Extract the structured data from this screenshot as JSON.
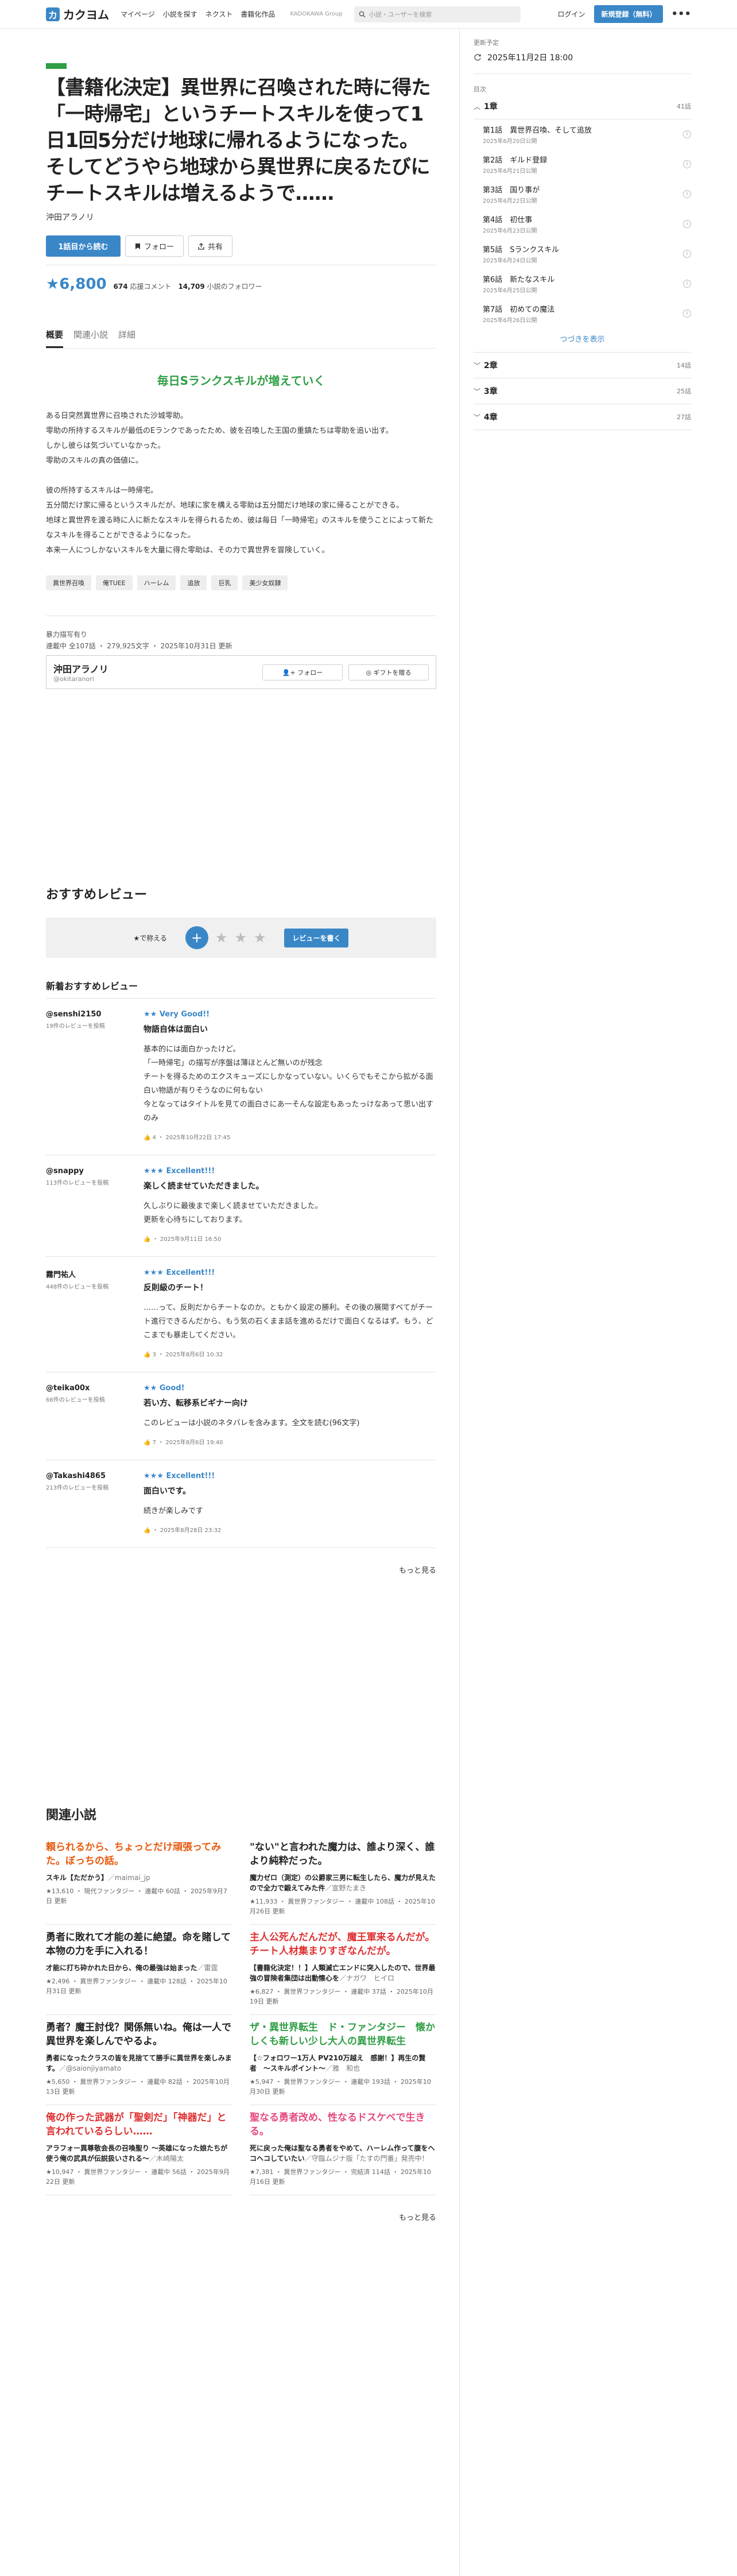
{
  "header": {
    "logo_mark": "カ",
    "logo_text": "カクヨム",
    "nav": [
      "マイページ",
      "小説を探す",
      "ネクスト",
      "書籍化作品"
    ],
    "kadokawa": "KADOKAWA Group",
    "search_placeholder": "小説・ユーザーを検索",
    "login": "ログイン",
    "register": "新規登録（無料）",
    "more": "•••"
  },
  "work": {
    "title": "【書籍化決定】異世界に召喚された時に得た「一時帰宅」というチートスキルを使って1日1回5分だけ地球に帰れるようになった。そしてどうやら地球から異世界に戻るたびにチートスキルは増えるようで……",
    "author": "沖田アラノリ",
    "read_btn": "1話目から読む",
    "follow_btn": "フォロー",
    "share_btn": "共有",
    "score": "★6,800",
    "comments_num": "674",
    "comments_label": " 応援コメント",
    "followers_num": "14,709",
    "followers_label": " 小説のフォロワー"
  },
  "tabs": [
    "概要",
    "関連小説",
    "詳細"
  ],
  "catchphrase": "毎日Sランクスキルが増えていく",
  "intro": "ある日突然異世界に召喚された沙城零助。\n零助の所持するスキルが最低のEランクであったため、彼を召喚した王国の重鎮たちは零助を追い出す。\nしかし彼らは気づいていなかった。\n零助のスキルの真の価値に。\n\n彼の所持するスキルは一時帰宅。\n五分間だけ家に帰るというスキルだが、地球に家を構える零助は五分間だけ地球の家に帰ることができる。\n地球と異世界を渡る時に人に新たなスキルを得られるため、彼は毎日「一時帰宅」のスキルを使うことによって新たなスキルを得ることができるようになった。\n本来一人につしかないスキルを大量に得た零助は、その力で異世界を冒険していく。",
  "tags": [
    "異世界召喚",
    "俺TUEE",
    "ハーレム",
    "追放",
    "巨乳",
    "美少女奴隷"
  ],
  "meta": {
    "line1": "暴力描写有り",
    "line2": "連載中 全107話 ・ 279,925文字 ・ 2025年10月31日 更新"
  },
  "author_card": {
    "name": "沖田アラノリ",
    "id": "@okitaranori",
    "follow": "フォロー",
    "gift": "ギフトを贈る"
  },
  "reviews_section": {
    "title": "おすすめレビュー",
    "rate_label": "★で称える",
    "plus": "+",
    "stars": [
      "★",
      "★",
      "★"
    ],
    "write_btn": "レビューを書く",
    "new_title": "新着おすすめレビュー",
    "more": "もっと見る"
  },
  "reviews": [
    {
      "user": "@senshi2150",
      "count": "19件のレビューを投稿",
      "rating": "★★ Very Good!!",
      "headline": "物語自体は面白い",
      "body": "基本的には面白かったけど。\n「一時帰宅」の描写が序盤は薄ほとんど無いのが残念\nチートを得るためのエクスキューズにしかなっていない。いくらでもそこから拡がる面白い物語が有りそうなのに何もない\n今となってはタイトルを見ての面白さにあ一そんな設定もあったっけなあって思い出すのみ",
      "likes": "4",
      "date": "2025年10月22日 17:45"
    },
    {
      "user": "@snappy",
      "count": "113件のレビューを投稿",
      "rating": "★★★ Excellent!!!",
      "headline": "楽しく読ませていただきました。",
      "body": "久しぶりに最後まで楽しく読ませていただきました。\n更新を心待ちにしております。",
      "likes": "",
      "date": "2025年9月11日 16:50"
    },
    {
      "user": "霧門祐人",
      "count": "448件のレビューを投稿",
      "rating": "★★★ Excellent!!!",
      "headline": "反則級のチート！",
      "body": "……って、反則だからチートなのか。ともかく設定の勝利。その後の展開すべてがチート進行できるんだから、もう気の石くまま話を進めるだけで面白くなるはず。もう、どこまでも暴走してください。",
      "likes": "3",
      "date": "2025年8月6日 10:32"
    },
    {
      "user": "@teika00x",
      "count": "66件のレビューを投稿",
      "rating": "★★ Good!",
      "headline": "若い方、転移系ビギナー向け",
      "body": "このレビューは小説のネタバレを含みます。全文を読む(96文字)",
      "likes": "7",
      "date": "2025年8月6日 19:40"
    },
    {
      "user": "@Takashi4865",
      "count": "213件のレビューを投稿",
      "rating": "★★★ Excellent!!!",
      "headline": "面白いです。",
      "body": "続きが楽しみです",
      "likes": "",
      "date": "2025年8月28日 23:32"
    }
  ],
  "related": {
    "title": "関連小説",
    "more": "もっと見る",
    "items": [
      {
        "name": "頼られるから、ちょっとだけ頑張ってみた。ぼっちの話。",
        "color": "#e8590c",
        "catch": "スキル【ただかう】",
        "author": "／maimai_jp",
        "meta": "★13,610 ・ 現代ファンタジー ・ 連載中 60話 ・ 2025年9月7日 更新"
      },
      {
        "name": "\"ない\"と言われた魔力は、誰より深く、誰より純粋だった。",
        "color": "#222222",
        "catch": "魔力ゼロ（測定）の公爵家三男に転生したら、魔力が見えたので全力で鍛えてみた件",
        "author": "／宣野たまき",
        "meta": "★11,933 ・ 異世界ファンタジー ・ 連載中 108話 ・ 2025年10月26日 更新"
      },
      {
        "name": "勇者に敗れて才能の差に絶望。命を賭して本物の力を手に入れる！",
        "color": "#222222",
        "catch": "才能に打ち砕かれた日から、俺の最強は始まった",
        "author": "／雷霆",
        "meta": "★2,496 ・ 異世界ファンタジー ・ 連載中 128話 ・ 2025年10月31日 更新"
      },
      {
        "name": "主人公死んだんだが、魔王軍来るんだが。チート人材集まりすぎなんだが。",
        "color": "#e03131",
        "catch": "【書籍化決定！！】人類滅亡エンドに突入したので、世界最強の冒険者集団は出動懐心を",
        "author": "／ナガワ　ヒイロ",
        "meta": "★6,827 ・ 異世界ファンタジー ・ 連載中 37話 ・ 2025年10月19日 更新"
      },
      {
        "name": "勇者？魔王討伐？関係無いね。俺は一人で異世界を楽しんでやるよ。",
        "color": "#222222",
        "catch": "勇者になったクラスの皆を見捨てて勝手に異世界を楽しみます。",
        "author": "／@saionjiyamato",
        "meta": "★5,650 ・ 異世界ファンタジー ・ 連載中 82話 ・ 2025年10月13日 更新"
      },
      {
        "name": "ザ・異世界転生　ド・ファンタジー　懐かしくも新しい少し大人の異世界転生",
        "color": "#2f9e44",
        "catch": "【☆フォロワー1万人 PV210万越え　感謝！】再生の賢者　〜スキルポイント〜",
        "author": "／雅　和也",
        "meta": "★5,947 ・ 異世界ファンタジー ・ 連載中 193話 ・ 2025年10月30日 更新"
      },
      {
        "name": "俺の作った武器が「聖剣だ」「神器だ」と言われているらしい……",
        "color": "#e03131",
        "catch": "アラフォー異尊敬会長の召喚聖り 〜英雄になった娘たちが使う俺の武具が伝説扱いされる〜",
        "author": "／木崎陽太",
        "meta": "★10,947 ・ 異世界ファンタジー ・ 連載中 56話 ・ 2025年9月22日 更新"
      },
      {
        "name": "聖なる勇者改め、性なるドスケベで生きる。",
        "color": "#e64980",
        "catch": "死に戻った俺は聖なる勇者をやめて、ハーレム作って腹をヘコヘコしていたい",
        "author": "／守臨ムジナ版「たすの門番」発売中！",
        "meta": "★7,381 ・ 異世界ファンタジー ・ 完結済 114話 ・ 2025年10月16日 更新"
      }
    ]
  },
  "sidebar": {
    "updated_label": "更新予定",
    "updated_value": "2025年11月2日 18:00",
    "toc_label": "目次",
    "chapters": [
      {
        "name": "1章",
        "count": "41話",
        "open": true
      },
      {
        "name": "2章",
        "count": "14話",
        "open": false
      },
      {
        "name": "3章",
        "count": "25話",
        "open": false
      },
      {
        "name": "4章",
        "count": "27話",
        "open": false
      }
    ],
    "episodes": [
      {
        "title": "第1話　異世界召喚、そして追放",
        "date": "2025年6月20日公開"
      },
      {
        "title": "第2話　ギルド登録",
        "date": "2025年6月21日公開"
      },
      {
        "title": "第3話　国り事が",
        "date": "2025年6月22日公開"
      },
      {
        "title": "第4話　初仕事",
        "date": "2025年6月23日公開"
      },
      {
        "title": "第5話　Sランクスキル",
        "date": "2025年6月24日公開"
      },
      {
        "title": "第6話　新たなスキル",
        "date": "2025年6月25日公開"
      },
      {
        "title": "第7話　初めての魔法",
        "date": "2025年6月26日公開"
      }
    ],
    "toc_more": "つづきを表示"
  },
  "colors": {
    "accent": "#3a87c8",
    "genre": "#2f9e44"
  }
}
